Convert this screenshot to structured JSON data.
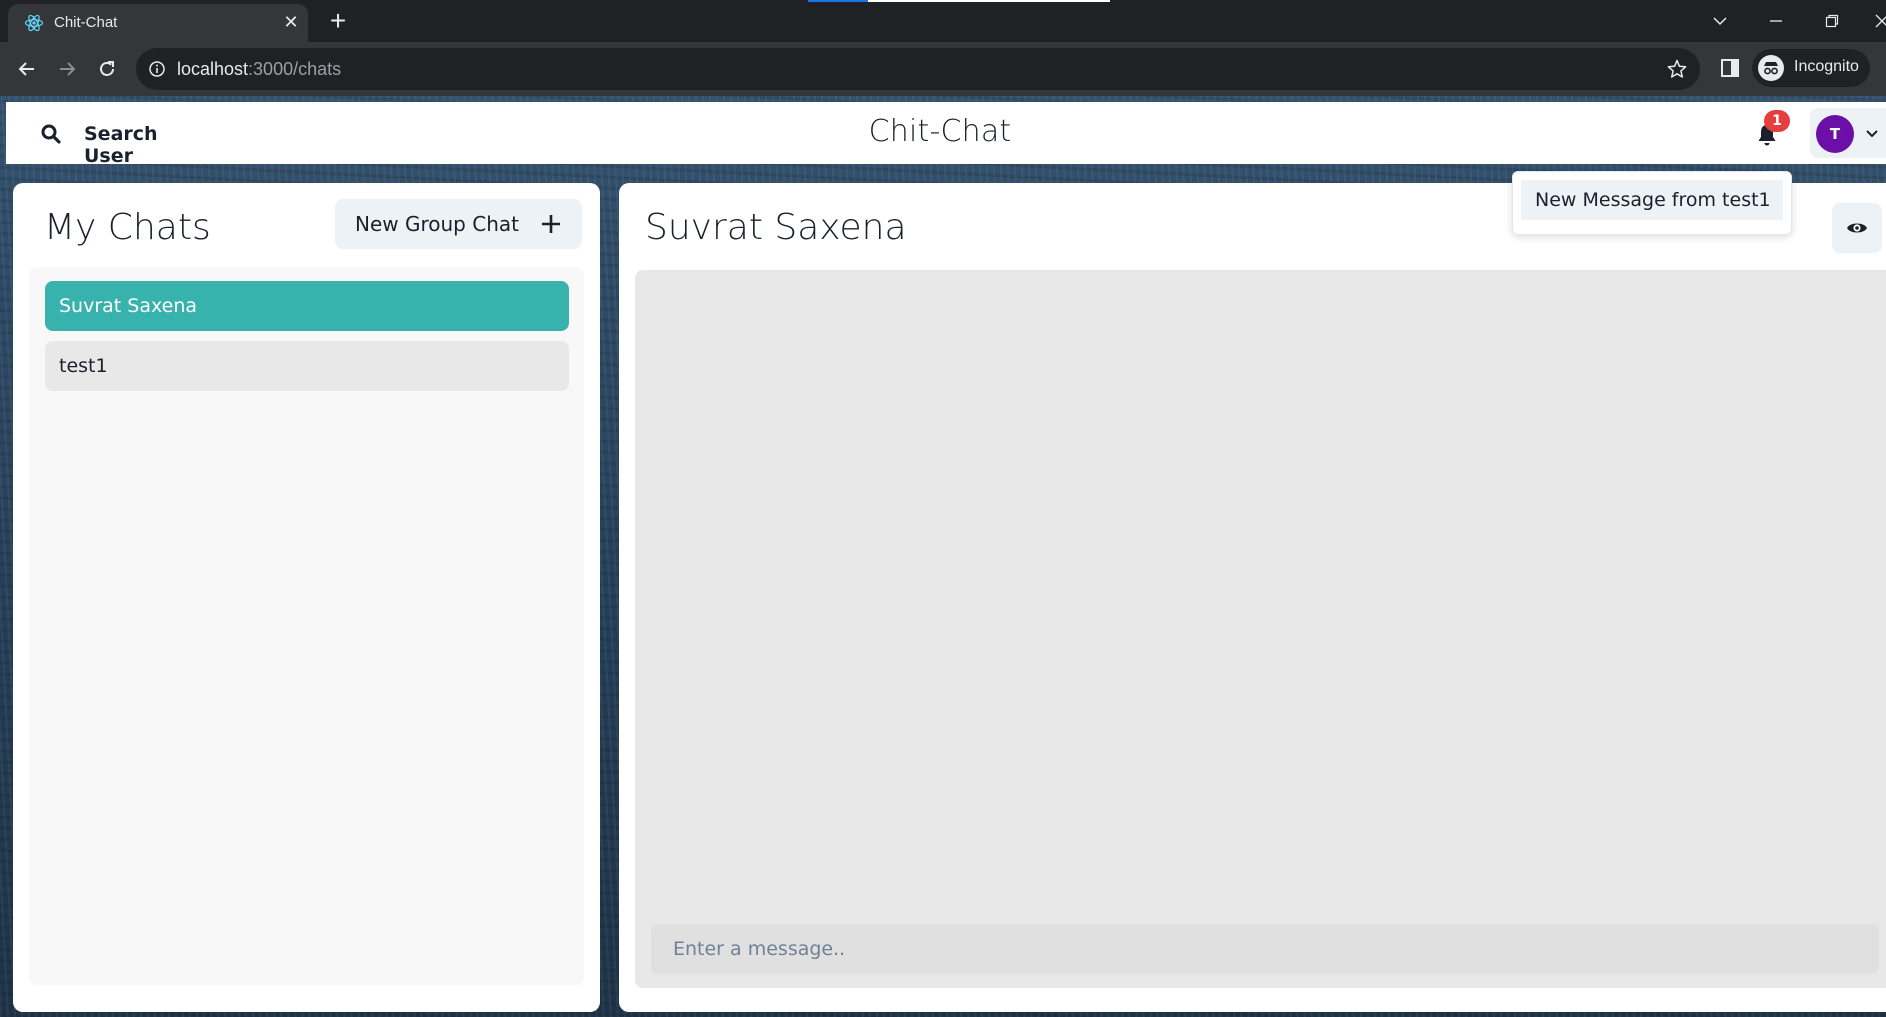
{
  "browser": {
    "tab_title": "Chit-Chat",
    "url_host": "localhost",
    "url_path": ":3000/chats",
    "profile_label": "Incognito"
  },
  "header": {
    "search_label": "Search User",
    "app_title": "Chit-Chat",
    "notification_count": "1",
    "avatar_initial": "T"
  },
  "notifications": {
    "items": [
      {
        "text": "New Message from test1"
      }
    ]
  },
  "sidebar": {
    "title": "My Chats",
    "new_group_label": "New Group Chat",
    "chats": [
      {
        "name": "Suvrat Saxena",
        "active": true
      },
      {
        "name": "test1",
        "active": false
      }
    ]
  },
  "chat": {
    "title": "Suvrat Saxena",
    "input_placeholder": "Enter a message.."
  },
  "colors": {
    "accent_teal": "#38b2ac",
    "avatar_purple": "#6b0fa8",
    "badge_red": "#e53e3e"
  }
}
